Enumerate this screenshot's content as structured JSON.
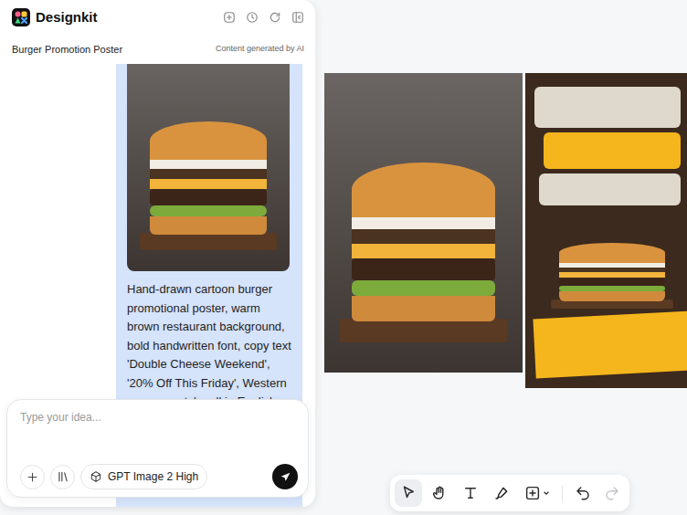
{
  "app": {
    "name": "Designkit"
  },
  "project": {
    "title": "Burger Promotion Poster",
    "note": "Content generated by AI"
  },
  "message": {
    "prompt": "Hand-drawn cartoon burger promotional poster, warm brown restaurant background, bold handwritten font, copy text 'Double Cheese Weekend', '20% Off This Friday', Western overseas style, all in English,"
  },
  "composer": {
    "placeholder": "Type your idea...",
    "model": "GPT Image 2 High"
  },
  "toolbar": {
    "tools": [
      {
        "kind": "select",
        "selected": true
      },
      {
        "kind": "hand",
        "selected": false
      },
      {
        "kind": "text",
        "selected": false
      },
      {
        "kind": "brush",
        "selected": false
      },
      {
        "kind": "shape",
        "selected": false
      }
    ],
    "history": [
      {
        "kind": "undo",
        "disabled": false
      },
      {
        "kind": "redo",
        "disabled": true
      }
    ]
  }
}
